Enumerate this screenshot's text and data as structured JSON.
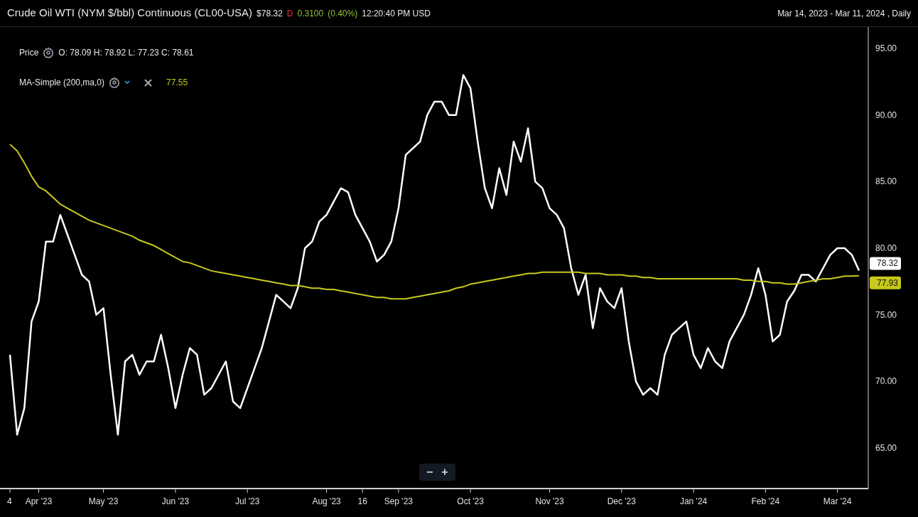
{
  "header": {
    "title": "Crude Oil WTI (NYM $/bbl) Continuous (CL00-USA)",
    "price": "$78.32",
    "direction": "D",
    "change": "0.3100",
    "change_pct": "(0.40%)",
    "time": "12:20:40 PM USD",
    "range": "Mar 14, 2023 - Mar 11, 2024 , Daily"
  },
  "legend": {
    "price": {
      "ohlc": "O: 78.09 H: 78.92 L: 77.23 C: 78.61"
    },
    "ma": {
      "value": "77.55"
    }
  },
  "zoom_controls": [
    "−",
    "+"
  ],
  "price_tags": [
    "78.32",
    "77.93"
  ],
  "chart_data": {
    "type": "line",
    "ylim": [
      61.96,
      96.6
    ],
    "categories": [
      "4",
      null,
      null,
      null,
      "Apr '23",
      null,
      null,
      null,
      null,
      null,
      null,
      null,
      null,
      "May '23",
      null,
      null,
      null,
      null,
      null,
      null,
      null,
      null,
      null,
      "Jun '23",
      null,
      null,
      null,
      null,
      null,
      null,
      null,
      null,
      null,
      "Jul '23",
      null,
      null,
      null,
      null,
      null,
      null,
      null,
      null,
      null,
      null,
      "Aug '23",
      null,
      null,
      null,
      null,
      "16",
      null,
      null,
      null,
      null,
      "Sep '23",
      null,
      null,
      null,
      null,
      null,
      null,
      null,
      null,
      null,
      "Oct '23",
      null,
      null,
      null,
      null,
      null,
      null,
      null,
      null,
      null,
      null,
      "Nov '23",
      null,
      null,
      null,
      null,
      null,
      null,
      null,
      null,
      null,
      "Dec '23",
      null,
      null,
      null,
      null,
      null,
      null,
      null,
      null,
      null,
      "Jan '24",
      null,
      null,
      null,
      null,
      null,
      null,
      null,
      null,
      null,
      "Feb '24",
      null,
      null,
      null,
      null,
      null,
      null,
      null,
      null,
      null,
      "Mar '24",
      null,
      null,
      null
    ],
    "series": [
      {
        "name": "Price",
        "color": "#ffffff",
        "values": [
          72,
          66,
          68,
          74.5,
          76,
          80.5,
          80.5,
          82.5,
          81,
          79.5,
          78,
          77.5,
          75,
          75.5,
          70.5,
          66,
          71.5,
          72,
          70.5,
          71.5,
          71.5,
          73.5,
          71,
          68,
          70.5,
          72.5,
          72,
          69,
          69.5,
          70.5,
          71.5,
          68.5,
          68,
          69.5,
          71,
          72.5,
          74.5,
          76.5,
          76,
          75.5,
          77,
          80,
          80.5,
          82,
          82.5,
          83.5,
          84.5,
          84.2,
          82.5,
          81.5,
          80.5,
          79,
          79.5,
          80.5,
          83,
          87,
          87.5,
          88,
          90,
          91,
          91,
          90,
          90,
          93,
          92,
          88,
          84.5,
          83,
          86,
          84,
          88,
          86.5,
          89,
          85,
          84.5,
          83,
          82.5,
          81.5,
          78.5,
          76.5,
          78,
          74,
          77,
          76,
          75.5,
          77,
          73,
          70,
          69,
          69.5,
          69,
          72,
          73.5,
          74,
          74.5,
          72,
          71,
          72.5,
          71.5,
          71,
          73,
          74,
          75,
          76.5,
          78.5,
          76.5,
          73,
          73.5,
          76,
          76.8,
          78,
          78,
          77.5,
          78.5,
          79.5,
          80,
          80,
          79.5,
          78.32
        ]
      },
      {
        "name": "MA-Simple (200,ma,0)",
        "color": "#c8c81e",
        "values": [
          87.8,
          87.3,
          86.4,
          85.4,
          84.6,
          84.3,
          83.8,
          83.3,
          83.0,
          82.7,
          82.4,
          82.1,
          81.9,
          81.7,
          81.5,
          81.3,
          81.1,
          80.9,
          80.6,
          80.4,
          80.2,
          79.9,
          79.6,
          79.3,
          79.0,
          78.9,
          78.7,
          78.5,
          78.3,
          78.2,
          78.1,
          78.0,
          77.9,
          77.8,
          77.7,
          77.6,
          77.5,
          77.4,
          77.3,
          77.2,
          77.2,
          77.1,
          77.0,
          77.0,
          76.9,
          76.9,
          76.8,
          76.7,
          76.6,
          76.5,
          76.4,
          76.3,
          76.3,
          76.2,
          76.2,
          76.2,
          76.3,
          76.4,
          76.5,
          76.6,
          76.7,
          76.8,
          77.0,
          77.1,
          77.3,
          77.4,
          77.5,
          77.6,
          77.7,
          77.8,
          77.9,
          78.0,
          78.1,
          78.1,
          78.2,
          78.2,
          78.2,
          78.2,
          78.2,
          78.2,
          78.1,
          78.1,
          78.1,
          78.0,
          78.0,
          78.0,
          77.9,
          77.9,
          77.8,
          77.8,
          77.7,
          77.7,
          77.7,
          77.7,
          77.7,
          77.7,
          77.7,
          77.7,
          77.7,
          77.7,
          77.7,
          77.7,
          77.6,
          77.6,
          77.5,
          77.5,
          77.4,
          77.4,
          77.3,
          77.3,
          77.4,
          77.5,
          77.6,
          77.7,
          77.7,
          77.8,
          77.9,
          77.9,
          77.93
        ]
      }
    ],
    "yticks": [
      {
        "value": 65,
        "label": "65.00"
      },
      {
        "value": 70,
        "label": "70.00"
      },
      {
        "value": 75,
        "label": "75.00"
      },
      {
        "value": 80,
        "label": "80.00"
      },
      {
        "value": 85,
        "label": "85.00"
      },
      {
        "value": 90,
        "label": "90.00"
      },
      {
        "value": 95,
        "label": "95.00"
      }
    ]
  }
}
